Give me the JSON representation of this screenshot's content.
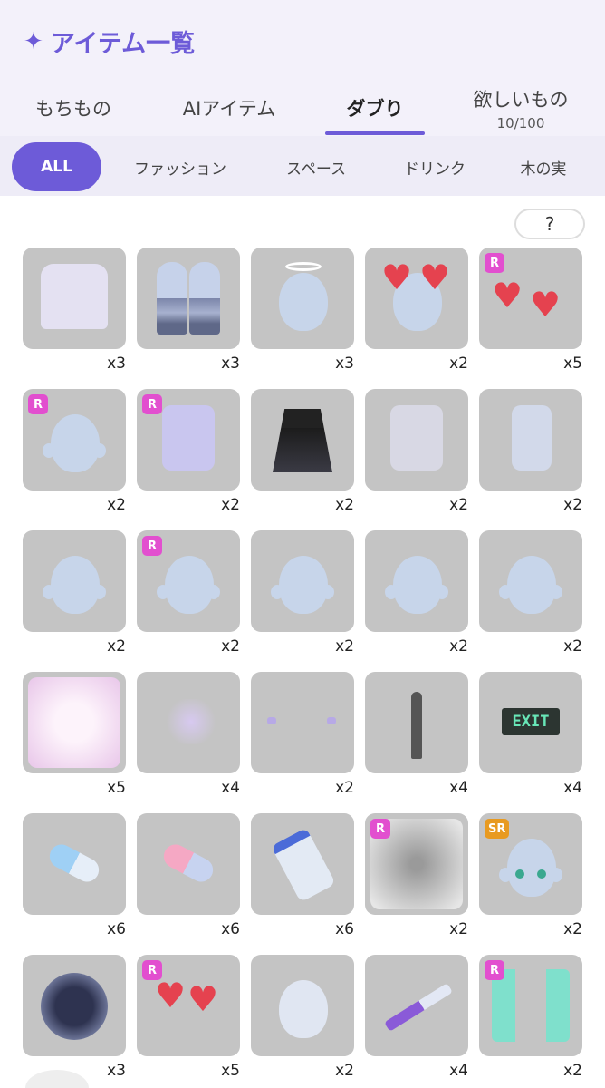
{
  "header": {
    "title": "アイテム一覧",
    "sparkle_icon": "sparkle-icon"
  },
  "tabs": [
    {
      "label": "もちもの",
      "sub": ""
    },
    {
      "label": "AIアイテム",
      "sub": ""
    },
    {
      "label": "ダブり",
      "sub": ""
    },
    {
      "label": "欲しいもの",
      "sub": "10/100"
    }
  ],
  "active_tab": "ダブり",
  "categories": [
    "ALL",
    "ファッション",
    "スペース",
    "ドリンク",
    "木の実"
  ],
  "active_category": "ALL",
  "help_label": "?",
  "colors": {
    "accent": "#6d5bd8",
    "badge_r": "#e24fcf",
    "badge_sr": "#e89a20",
    "tile": "#c4c4c4"
  },
  "items": [
    {
      "name": "bunny-shirt",
      "badge": "",
      "count": "x3"
    },
    {
      "name": "striped-legwarmers",
      "badge": "",
      "count": "x3"
    },
    {
      "name": "halo",
      "badge": "",
      "count": "x3"
    },
    {
      "name": "heart-eyes",
      "badge": "",
      "count": "x2"
    },
    {
      "name": "winged-hearts",
      "badge": "R",
      "count": "x5"
    },
    {
      "name": "blush-face",
      "badge": "R",
      "count": "x2"
    },
    {
      "name": "ribbon-sleeves",
      "badge": "R",
      "count": "x2"
    },
    {
      "name": "black-frill-skirt",
      "badge": "",
      "count": "x2"
    },
    {
      "name": "harness-top",
      "badge": "",
      "count": "x2"
    },
    {
      "name": "shorts",
      "badge": "",
      "count": "x2"
    },
    {
      "name": "bandage-face",
      "badge": "",
      "count": "x2"
    },
    {
      "name": "bunny-hairpins",
      "badge": "R",
      "count": "x2"
    },
    {
      "name": "sleepy-eyes",
      "badge": "",
      "count": "x2"
    },
    {
      "name": "heart-earrings",
      "badge": "",
      "count": "x2"
    },
    {
      "name": "pink-cheeks",
      "badge": "",
      "count": "x2"
    },
    {
      "name": "pink-glow-background",
      "badge": "",
      "count": "x5"
    },
    {
      "name": "bunny-friends",
      "badge": "",
      "count": "x4"
    },
    {
      "name": "small-ornaments",
      "badge": "",
      "count": "x2"
    },
    {
      "name": "silhouette",
      "badge": "",
      "count": "x4"
    },
    {
      "name": "exit-sign",
      "badge": "",
      "count": "x4",
      "text": "EXIT"
    },
    {
      "name": "blue-pill",
      "badge": "",
      "count": "x6"
    },
    {
      "name": "pink-pill",
      "badge": "",
      "count": "x6"
    },
    {
      "name": "pill-jar",
      "badge": "",
      "count": "x6"
    },
    {
      "name": "blurred-background",
      "badge": "R",
      "count": "x2"
    },
    {
      "name": "teary-eyes",
      "badge": "SR",
      "count": "x2"
    },
    {
      "name": "dark-orb",
      "badge": "",
      "count": "x3"
    },
    {
      "name": "heart-bouquet",
      "badge": "R",
      "count": "x5"
    },
    {
      "name": "bandaged-head",
      "badge": "",
      "count": "x2"
    },
    {
      "name": "syringe",
      "badge": "",
      "count": "x4"
    },
    {
      "name": "mint-door",
      "badge": "R",
      "count": "x2"
    }
  ]
}
